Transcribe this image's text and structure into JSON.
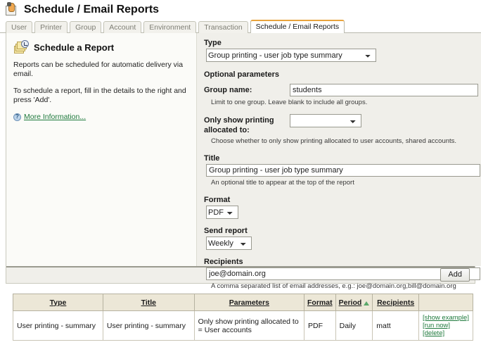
{
  "header": {
    "title": "Schedule / Email Reports",
    "icon": "clipboard-hand-icon"
  },
  "tabs": [
    {
      "label": "User",
      "active": false
    },
    {
      "label": "Printer",
      "active": false
    },
    {
      "label": "Group",
      "active": false
    },
    {
      "label": "Account",
      "active": false
    },
    {
      "label": "Environment",
      "active": false
    },
    {
      "label": "Transaction",
      "active": false
    },
    {
      "label": "Schedule / Email Reports",
      "active": true
    }
  ],
  "left_panel": {
    "icon": "reports-clock-icon",
    "heading": "Schedule a Report",
    "paragraph1": "Reports can be scheduled for automatic delivery via email.",
    "paragraph2": "To schedule a report, fill in the details to the right and press 'Add'.",
    "more_info_icon": "info-question-icon",
    "more_info_label": "More Information..."
  },
  "form": {
    "type_label": "Type",
    "type_value": "Group printing - user job type summary",
    "optional_params_label": "Optional parameters",
    "group_name_label": "Group name:",
    "group_name_value": "students",
    "group_name_hint": "Limit to one group. Leave blank to include all groups.",
    "allocated_label_line1": "Only show printing",
    "allocated_label_line2": "allocated to:",
    "allocated_value": "",
    "allocated_hint": "Choose whether to only show printing allocated to user accounts, shared accounts.",
    "title_label": "Title",
    "title_value": "Group printing - user job type summary",
    "title_hint": "An optional title to appear at the top of the report",
    "format_label": "Format",
    "format_value": "PDF",
    "send_report_label": "Send report",
    "send_report_value": "Weekly",
    "recipients_label": "Recipients",
    "recipients_value": "joe@domain.org",
    "recipients_hint": "A comma separated list of email addresses, e.g.: joe@domain.org,bill@domain.org",
    "add_button_label": "Add"
  },
  "table": {
    "columns": [
      "Type",
      "Title",
      "Parameters",
      "Format",
      "Period",
      "Recipients",
      ""
    ],
    "sorted_column": "Period",
    "sort_direction": "asc",
    "rows": [
      {
        "type": "User printing - summary",
        "title": "User printing - summary",
        "parameters": "Only show printing allocated to = User accounts",
        "format": "PDF",
        "period": "Daily",
        "recipients": "matt",
        "actions": [
          "[show example]",
          "[run now]",
          "[delete]"
        ]
      }
    ]
  },
  "colors": {
    "accent_tab": "#e8a33d",
    "link_green": "#1f7a3d",
    "table_header_bg": "#ece7d7",
    "sort_arrow": "#5aa86a"
  }
}
